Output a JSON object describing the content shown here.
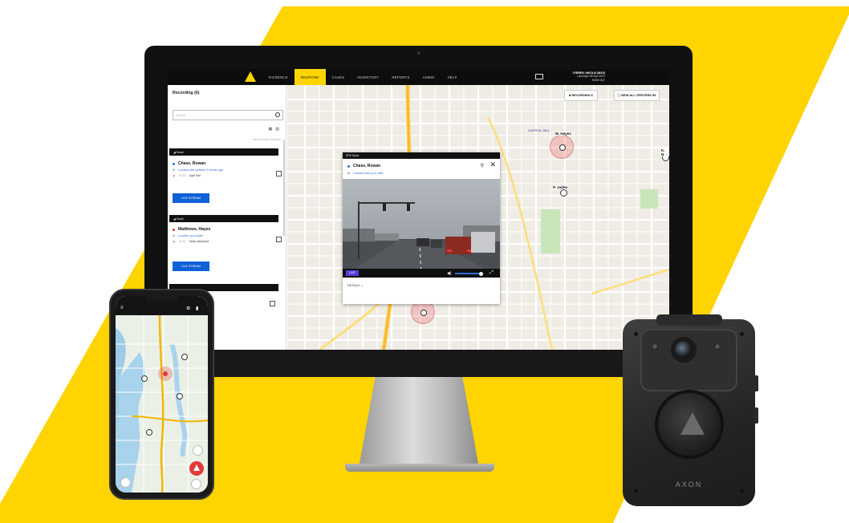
{
  "brand": {
    "accent": "#ffd400",
    "primary_blue": "#1060d8"
  },
  "topnav": {
    "items": [
      "EVIDENCE",
      "RESPOND",
      "CASES",
      "INVENTORY",
      "REPORTS",
      "ADMIN",
      "HELP"
    ],
    "active": "RESPOND",
    "user_name": "O'BRIEN, NIKOLAI (MXX)",
    "user_sub": "Last login 08 Nov 2021",
    "signout": "SIGN OUT"
  },
  "sidebar": {
    "title": "Recording (6)",
    "search_placeholder": "Search",
    "stream_note": "Stream Active Selected",
    "groups": [
      {
        "header": "Good",
        "officer": "Chase, Rowan",
        "dot_color": "#2f6fd6",
        "location": "Location last updated 5 minute ago",
        "event_time": "12:32",
        "event": "Light Bar",
        "button": "LIVE STREAM"
      },
      {
        "header": "Good",
        "officer": "Matthews, Hayes",
        "dot_color": "#e03b3b",
        "location": "Location up-to-date",
        "event_time": "12:32",
        "event": "Taser deployed",
        "button": "LIVE STREAM"
      }
    ]
  },
  "map": {
    "recording_button": "RECORDING 6",
    "view_all_button": "VIEW ALL OFFICERS 55",
    "district": "CAPITOL HILL",
    "markers": [
      "M. Hayes",
      "P. Jaden",
      "C. Rowan",
      "K. N"
    ]
  },
  "popup": {
    "status": "97%   Good",
    "officer": "Chase, Rowan",
    "location": "Location last up-to-date",
    "live": "LIVE",
    "details": "DETAILS"
  },
  "bodycam": {
    "brand": "AXON"
  }
}
